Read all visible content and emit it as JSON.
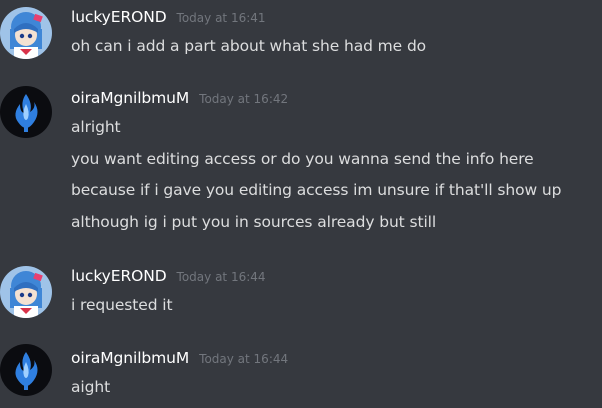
{
  "messages": [
    {
      "username": "luckyEROND",
      "timestamp": "Today at 16:41",
      "avatar": "anime-character-avatar",
      "lines": [
        "oh can i add a part about what she had me do"
      ]
    },
    {
      "username": "oiraMgnilbmuM",
      "timestamp": "Today at 16:42",
      "avatar": "blue-flame-avatar",
      "lines": [
        "alright",
        "you want editing access or do you wanna send the info here",
        "because if i gave you editing access im unsure if that'll show up",
        "although ig i put you in sources already but still"
      ]
    },
    {
      "username": "luckyEROND",
      "timestamp": "Today at 16:44",
      "avatar": "anime-character-avatar",
      "lines": [
        "i requested it"
      ]
    },
    {
      "username": "oiraMgnilbmuM",
      "timestamp": "Today at 16:44",
      "avatar": "blue-flame-avatar",
      "lines": [
        "aight"
      ]
    }
  ],
  "colors": {
    "background": "#36393f",
    "username": "#ffffff",
    "timestamp": "#72767d",
    "message_text": "#dcddde"
  }
}
